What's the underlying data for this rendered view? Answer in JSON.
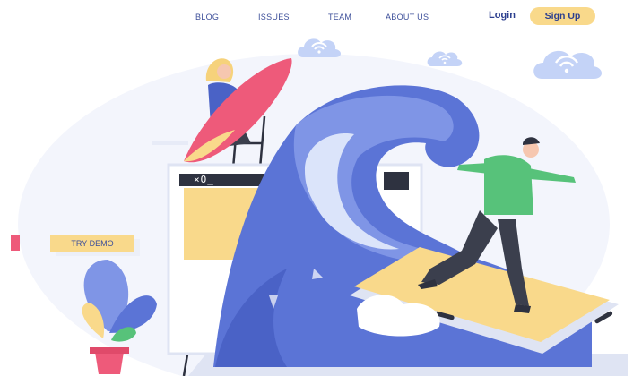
{
  "nav": {
    "links": [
      "BLOG",
      "ISSUES",
      "TEAM",
      "ABOUT US"
    ],
    "login_label": "Login",
    "signup_label": "Sign Up"
  },
  "hero": {
    "cta_label": "TRY DEMO"
  },
  "window": {
    "terminal_glyphs": "×O_"
  },
  "icons": {
    "cloud": "wifi-cloud-icon",
    "wave": "wave-icon",
    "plant": "plant-icon",
    "surfboard": "surfboard-icon"
  },
  "colors": {
    "accent_yellow": "#f9d98b",
    "nav_text": "#3d4f9a",
    "accent_pink": "#ee5a7a",
    "wave_blue": "#5b74d6",
    "cloud_blue": "#c4d3f7"
  }
}
